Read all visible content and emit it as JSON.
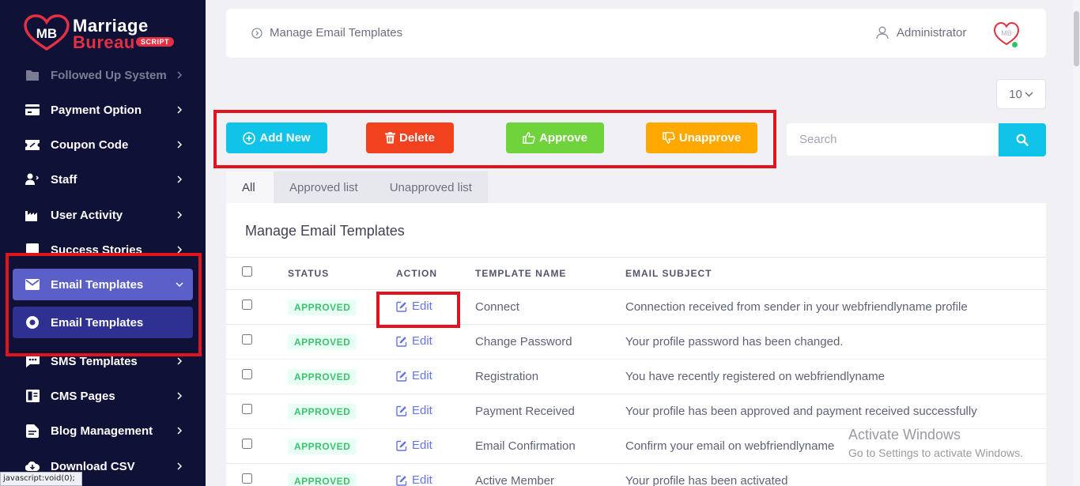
{
  "brand": {
    "line1": "Marriage",
    "line2": "Bureau",
    "badge": "SCRIPT",
    "mark": "MB"
  },
  "sidebar": {
    "items": [
      {
        "label": "Followed Up System"
      },
      {
        "label": "Payment Option"
      },
      {
        "label": "Coupon Code"
      },
      {
        "label": "Staff"
      },
      {
        "label": "User Activity"
      },
      {
        "label": "Success Stories"
      },
      {
        "label": "Email Templates"
      },
      {
        "label": "Email Templates"
      },
      {
        "label": "SMS Templates"
      },
      {
        "label": "CMS Pages"
      },
      {
        "label": "Blog Management"
      },
      {
        "label": "Download CSV"
      }
    ]
  },
  "statusbar": {
    "text": "javascript:void(0);"
  },
  "header": {
    "breadcrumb": "Manage Email Templates",
    "user": "Administrator",
    "avatar": "MB"
  },
  "perpage": {
    "value": "10"
  },
  "toolbar": {
    "add": "Add New",
    "delete": "Delete",
    "approve": "Approve",
    "unapprove": "Unapprove"
  },
  "search": {
    "placeholder": "Search"
  },
  "tabs": [
    {
      "label": "All"
    },
    {
      "label": "Approved list"
    },
    {
      "label": "Unapproved list"
    }
  ],
  "card": {
    "title": "Manage Email Templates",
    "columns": {
      "status": "STATUS",
      "action": "ACTION",
      "name": "TEMPLATE NAME",
      "subject": "EMAIL SUBJECT"
    },
    "rows": [
      {
        "status": "APPROVED",
        "action": "Edit",
        "name": "Connect",
        "subject": "Connection received from sender in your webfriendlyname profile"
      },
      {
        "status": "APPROVED",
        "action": "Edit",
        "name": "Change Password",
        "subject": "Your profile password has been changed."
      },
      {
        "status": "APPROVED",
        "action": "Edit",
        "name": "Registration",
        "subject": "You have recently registered on webfriendlyname"
      },
      {
        "status": "APPROVED",
        "action": "Edit",
        "name": "Payment Received",
        "subject": "Your profile has been approved and payment received successfully"
      },
      {
        "status": "APPROVED",
        "action": "Edit",
        "name": "Email Confirmation",
        "subject": "Confirm your email on webfriendlyname"
      },
      {
        "status": "APPROVED",
        "action": "Edit",
        "name": "Active Member",
        "subject": "Your profile has been activated"
      }
    ]
  },
  "watermark": {
    "line1": "Activate Windows",
    "line2": "Go to Settings to activate Windows."
  },
  "colors": {
    "sidebar": "#0f1136",
    "active_parent": "#5b5fc7",
    "active_child": "#2e3192",
    "add": "#10c3e8",
    "delete": "#f1411e",
    "approve": "#6fd33c",
    "unapprove": "#ffa800",
    "highlight": "#e1131c"
  }
}
